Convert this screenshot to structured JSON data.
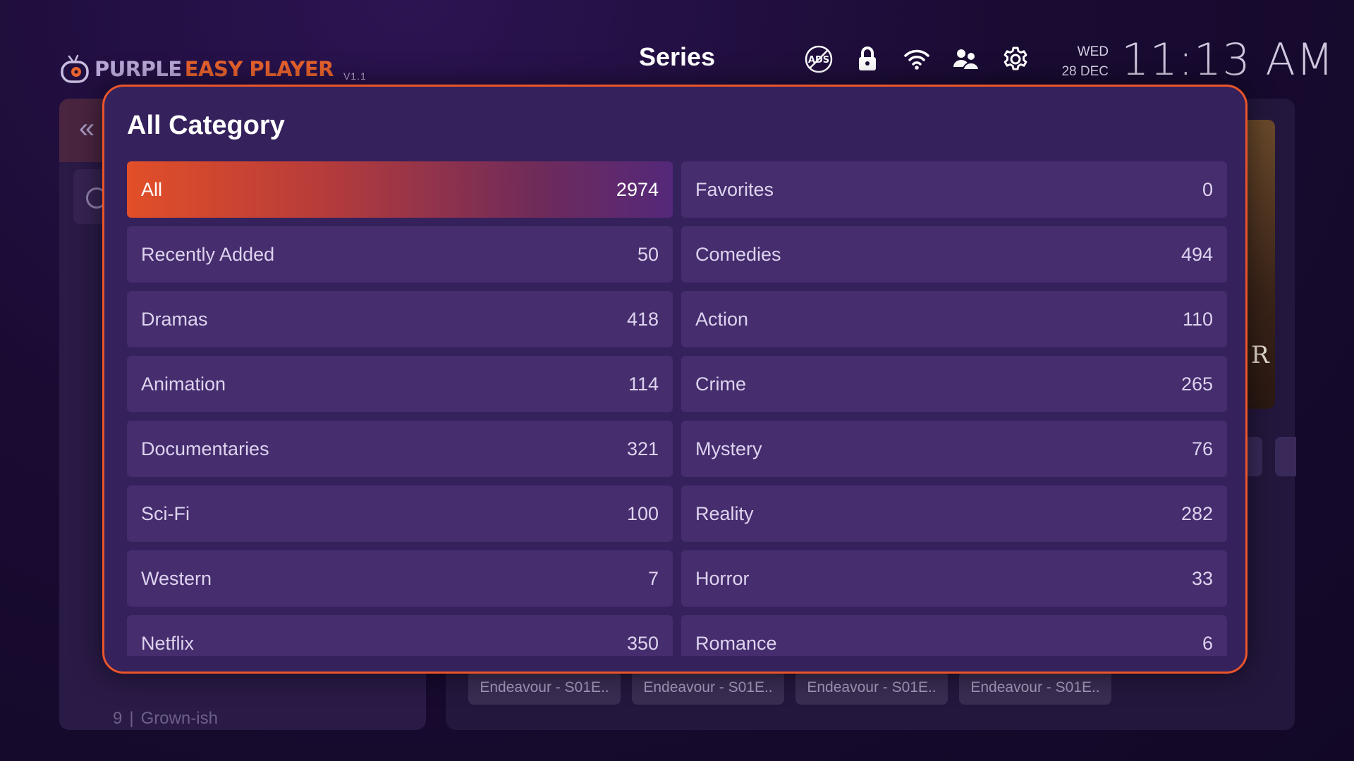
{
  "header": {
    "logo": {
      "word1": "PURPLE",
      "word2": "EASY PLAYER",
      "version": "V1.1"
    },
    "title": "Series",
    "icons": [
      "ads-off-icon",
      "lock-icon",
      "wifi-icon",
      "users-icon",
      "gear-icon"
    ],
    "day": "WED",
    "date": "28 DEC",
    "time": "11:13 AM"
  },
  "background": {
    "footer_number": "9",
    "footer_label": "Grown-ish",
    "poster_letter": "R",
    "chips": [
      "Endeavour - S01E..",
      "Endeavour - S01E..",
      "Endeavour - S01E..",
      "Endeavour - S01E.."
    ]
  },
  "modal": {
    "title": "All Category",
    "categories": [
      {
        "name": "All",
        "count": "2974"
      },
      {
        "name": "Favorites",
        "count": "0"
      },
      {
        "name": "Recently Added",
        "count": "50"
      },
      {
        "name": "Comedies",
        "count": "494"
      },
      {
        "name": "Dramas",
        "count": "418"
      },
      {
        "name": "Action",
        "count": "110"
      },
      {
        "name": "Animation",
        "count": "114"
      },
      {
        "name": "Crime",
        "count": "265"
      },
      {
        "name": "Documentaries",
        "count": "321"
      },
      {
        "name": "Mystery",
        "count": "76"
      },
      {
        "name": "Sci-Fi",
        "count": "100"
      },
      {
        "name": "Reality",
        "count": "282"
      },
      {
        "name": "Western",
        "count": "7"
      },
      {
        "name": "Horror",
        "count": "33"
      },
      {
        "name": "Netflix",
        "count": "350"
      },
      {
        "name": "Romance",
        "count": "6"
      }
    ],
    "selected": "All"
  },
  "colors": {
    "accent": "#e9552b",
    "modal_bg": "#35215c",
    "item_bg": "#452d6e"
  }
}
